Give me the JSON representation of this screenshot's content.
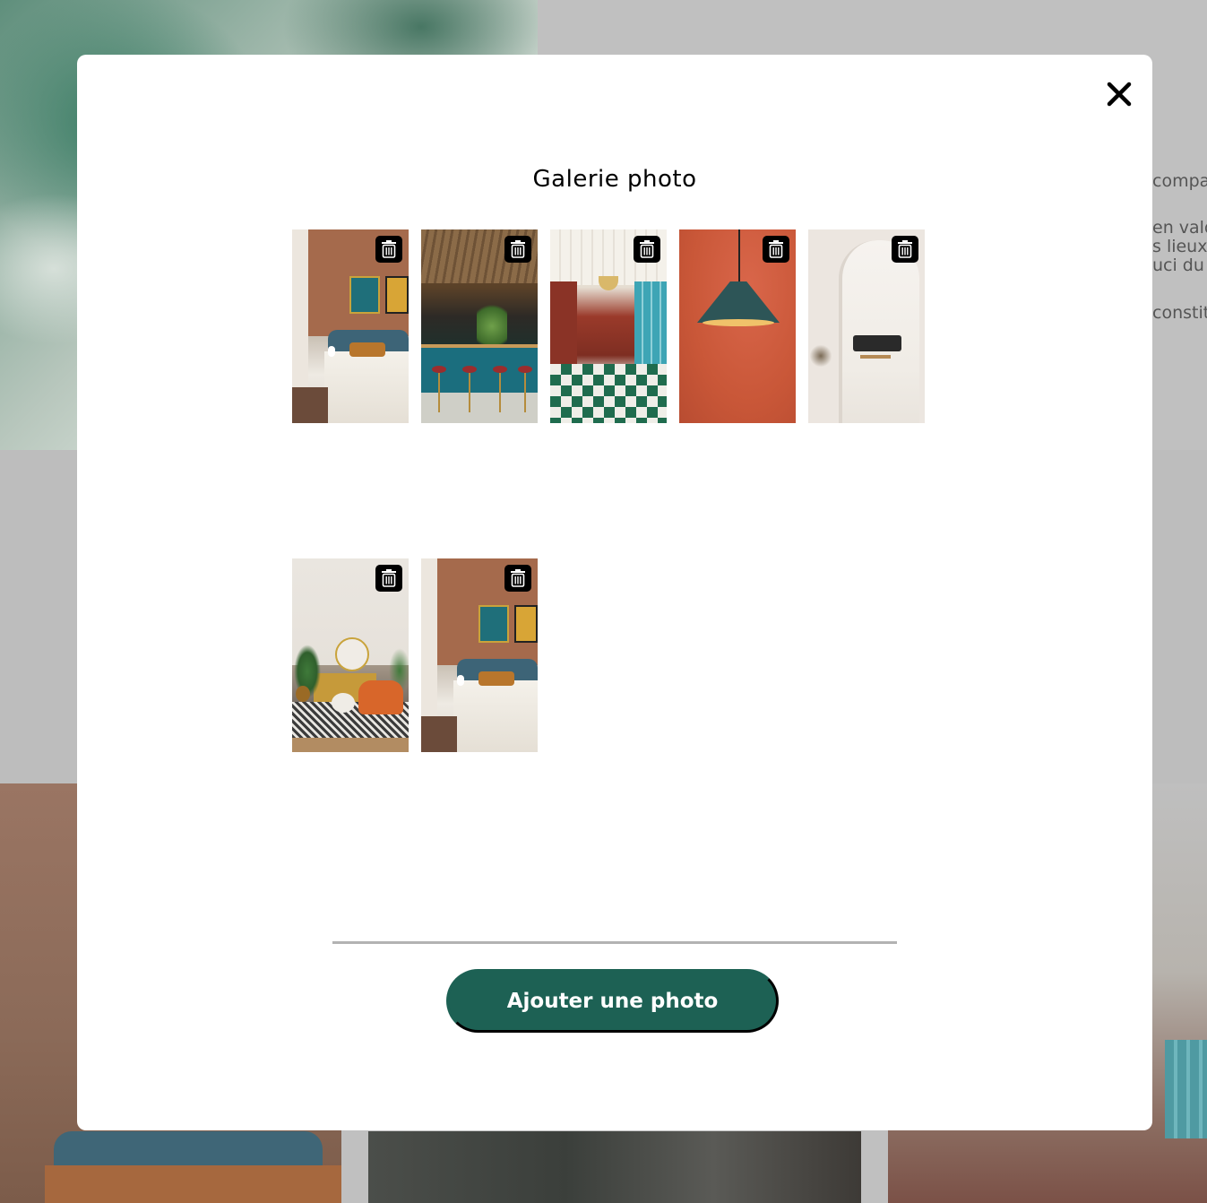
{
  "background_page": {
    "partial_text_lines": [
      "compa",
      "en valo",
      "s lieux",
      "uci du",
      "constit"
    ]
  },
  "modal": {
    "title": "Galerie photo",
    "close_icon": "close-icon",
    "photos": [
      {
        "subject": "bedroom with terracotta wall",
        "delete_icon": "trash-icon"
      },
      {
        "subject": "bar with teal counter",
        "delete_icon": "trash-icon"
      },
      {
        "subject": "restaurant hall with checkered floor",
        "delete_icon": "trash-icon"
      },
      {
        "subject": "pendant lamp on orange wall",
        "delete_icon": "trash-icon"
      },
      {
        "subject": "white arched room with sofa",
        "delete_icon": "trash-icon"
      },
      {
        "subject": "living room with orange armchair",
        "delete_icon": "trash-icon"
      },
      {
        "subject": "bedroom with terracotta wall",
        "delete_icon": "trash-icon"
      }
    ],
    "add_button_label": "Ajouter une photo"
  },
  "colors": {
    "primary_button": "#1d6154",
    "overlay": "#c0c0c0",
    "modal_background": "#ffffff",
    "divider": "#b3b3b3"
  }
}
